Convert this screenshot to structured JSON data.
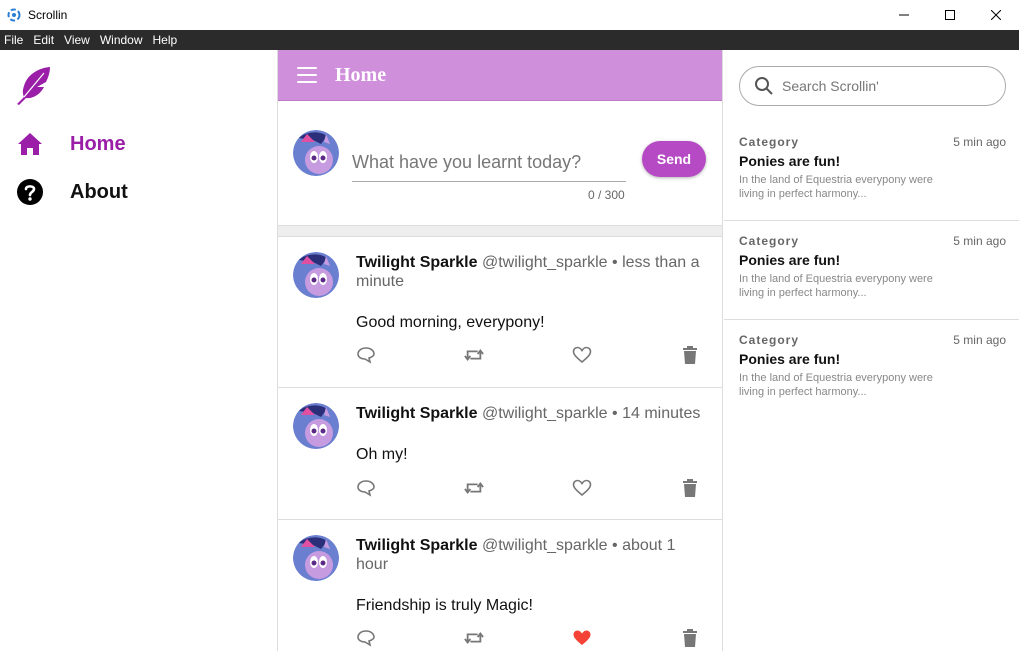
{
  "window": {
    "title": "Scrollin"
  },
  "menu": [
    "File",
    "Edit",
    "View",
    "Window",
    "Help"
  ],
  "sidebar": {
    "items": [
      {
        "label": "Home",
        "icon": "home-icon"
      },
      {
        "label": "About",
        "icon": "help-circle-icon"
      }
    ]
  },
  "header": {
    "title": "Home"
  },
  "composer": {
    "placeholder": "What have you learnt today?",
    "counter": "0 / 300",
    "send_label": "Send"
  },
  "posts": [
    {
      "name": "Twilight Sparkle",
      "handle": "@twilight_sparkle",
      "time": "• less than a minute",
      "body": "Good morning, everypony!",
      "liked": false
    },
    {
      "name": "Twilight Sparkle",
      "handle": "@twilight_sparkle",
      "time": "• 14 minutes",
      "body": "Oh my!",
      "liked": false
    },
    {
      "name": "Twilight Sparkle",
      "handle": "@twilight_sparkle",
      "time": "• about 1 hour",
      "body": "Friendship is truly Magic!",
      "liked": true
    }
  ],
  "search": {
    "placeholder": "Search Scrollin'"
  },
  "trends": [
    {
      "category": "Category",
      "time": "5 min ago",
      "title": "Ponies are fun!",
      "desc": "In the land of Equestria everypony were living in perfect harmony..."
    },
    {
      "category": "Category",
      "time": "5 min ago",
      "title": "Ponies are fun!",
      "desc": "In the land of Equestria everypony were living in perfect harmony..."
    },
    {
      "category": "Category",
      "time": "5 min ago",
      "title": "Ponies are fun!",
      "desc": "In the land of Equestria everypony were living in perfect harmony..."
    }
  ],
  "colors": {
    "accent": "#9a1ea8",
    "header": "#cf8fdb",
    "send": "#b64ac4",
    "like": "#f44336"
  }
}
